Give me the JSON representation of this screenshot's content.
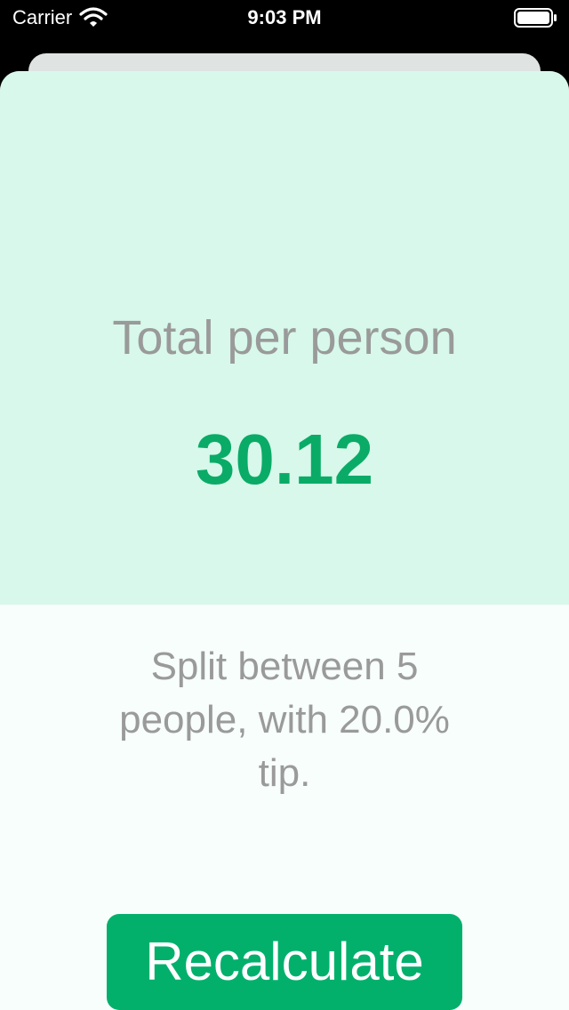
{
  "status_bar": {
    "carrier": "Carrier",
    "time": "9:03 PM",
    "wifi_icon": "wifi-icon",
    "battery_icon": "battery-icon"
  },
  "result": {
    "total_label": "Total per person",
    "total_value": "30.12",
    "settings": "Split between 5 people, with 20.0% tip."
  },
  "actions": {
    "recalculate_label": "Recalculate"
  },
  "colors": {
    "accent_green": "#02b06c",
    "value_green": "#0aab67",
    "top_panel_bg": "#d7f8ea",
    "bottom_bg": "#f7fefb",
    "label_gray": "#9a9a9a"
  }
}
